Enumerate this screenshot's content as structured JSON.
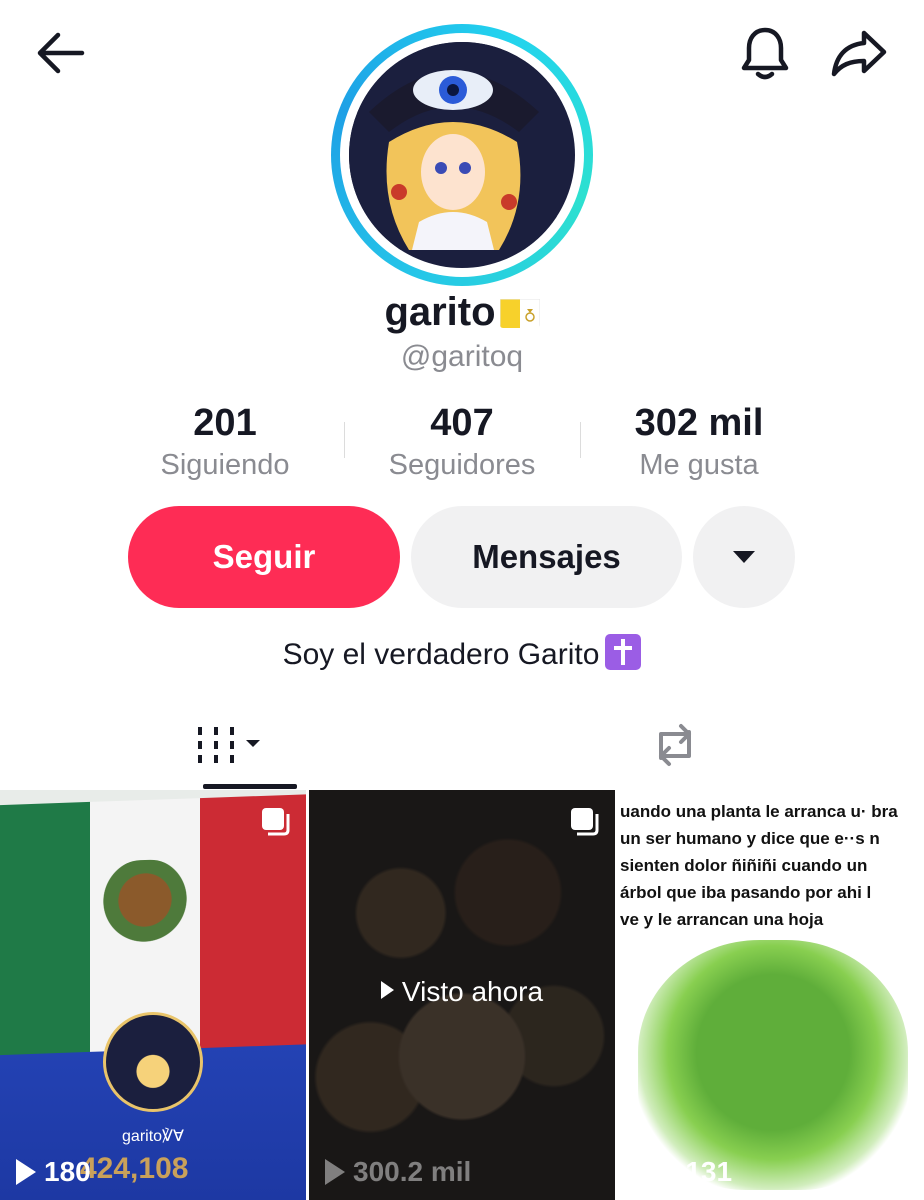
{
  "header": {
    "back_icon": "arrow-left-icon",
    "bell_icon": "bell-icon",
    "share_icon": "share-arrow-icon"
  },
  "profile": {
    "display_name": "garito",
    "handle": "@garitoq",
    "bio": "Soy el verdadero Garito",
    "flag_icon": "vatican-flag-icon",
    "bio_icon": "latin-cross-icon"
  },
  "stats": [
    {
      "value": "201",
      "label": "Siguiendo"
    },
    {
      "value": "407",
      "label": "Seguidores"
    },
    {
      "value": "302 mil",
      "label": "Me gusta"
    }
  ],
  "actions": {
    "follow_label": "Seguir",
    "message_label": "Mensajes",
    "more_icon": "caret-down-icon"
  },
  "tabs": {
    "videos_icon": "grid-videos-icon",
    "reposts_icon": "repost-icon"
  },
  "videos": [
    {
      "views": "180",
      "channel": "garito℣Ɐ",
      "score": "424,108"
    },
    {
      "views": "300.2 mil",
      "overlay": "Visto ahora"
    },
    {
      "views": "9,131",
      "caption_lines": [
        "uando una planta le arranca u· bra",
        "un ser humano y dice que e··s n",
        "sienten dolor ñiñiñi cuando un",
        "árbol que iba pasando por ahi l",
        "ve y le arrancan una hoja"
      ]
    }
  ],
  "colors": {
    "follow": "#fe2c55",
    "secondary_button": "#f1f1f2",
    "muted_text": "#8a8b91",
    "avatar_ring": "#25c6e8"
  }
}
